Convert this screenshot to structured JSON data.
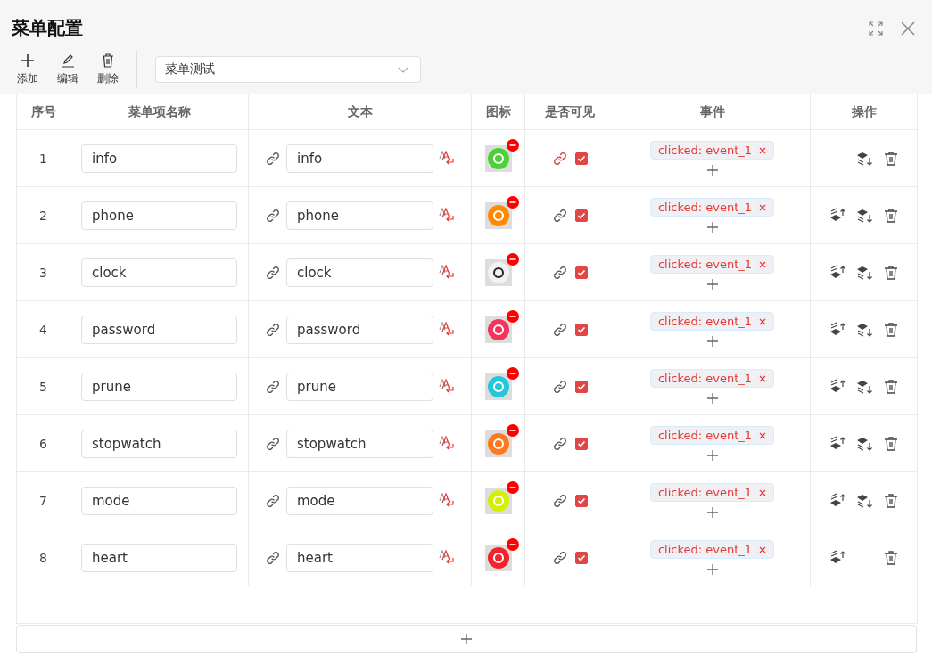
{
  "dialog": {
    "title": "菜单配置"
  },
  "toolbar": [
    {
      "kind": "add",
      "label": "添加"
    },
    {
      "kind": "edit",
      "label": "编辑"
    },
    {
      "kind": "delete",
      "label": "删除"
    }
  ],
  "menu_select": {
    "value": "菜单测试"
  },
  "table": {
    "columns": [
      "序号",
      "菜单项名称",
      "文本",
      "图标",
      "是否可见",
      "事件",
      "操作"
    ],
    "rows": [
      {
        "index": "1",
        "name": "info",
        "text": "info",
        "color": "#4cd137",
        "linked": true,
        "visible": true,
        "event": "clicked: event_1",
        "can_move_up": false,
        "can_move_down": true
      },
      {
        "index": "2",
        "name": "phone",
        "text": "phone",
        "color": "#ff8a00",
        "linked": false,
        "visible": true,
        "event": "clicked: event_1",
        "can_move_up": true,
        "can_move_down": true
      },
      {
        "index": "3",
        "name": "clock",
        "text": "clock",
        "color": "#f2f2f2",
        "linked": false,
        "visible": true,
        "event": "clicked: event_1",
        "can_move_up": true,
        "can_move_down": true
      },
      {
        "index": "4",
        "name": "password",
        "text": "password",
        "color": "#f5345a",
        "linked": false,
        "visible": true,
        "event": "clicked: event_1",
        "can_move_up": true,
        "can_move_down": true
      },
      {
        "index": "5",
        "name": "prune",
        "text": "prune",
        "color": "#26c6da",
        "linked": false,
        "visible": true,
        "event": "clicked: event_1",
        "can_move_up": true,
        "can_move_down": true
      },
      {
        "index": "6",
        "name": "stopwatch",
        "text": "stopwatch",
        "color": "#ff7a1f",
        "linked": false,
        "visible": true,
        "event": "clicked: event_1",
        "can_move_up": true,
        "can_move_down": true
      },
      {
        "index": "7",
        "name": "mode",
        "text": "mode",
        "color": "#d4f000",
        "linked": false,
        "visible": true,
        "event": "clicked: event_1",
        "can_move_up": true,
        "can_move_down": true
      },
      {
        "index": "8",
        "name": "heart",
        "text": "heart",
        "color": "#f5222d",
        "linked": false,
        "visible": true,
        "event": "clicked: event_1",
        "can_move_up": true,
        "can_move_down": false
      }
    ]
  }
}
